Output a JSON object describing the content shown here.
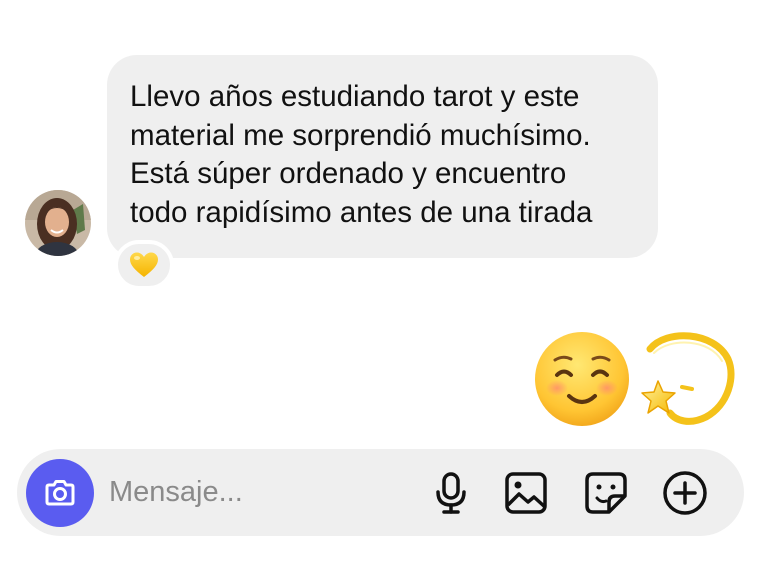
{
  "conversation": {
    "incoming": {
      "avatar_icon": "contact-avatar",
      "lines": [
        "Llevo años estudiando tarot y este",
        "material me sorprendió muchísimo.",
        "Está súper ordenado y encuentro",
        "todo rapidísimo antes de una tirada"
      ],
      "reaction_icon": "yellow-heart-icon"
    },
    "outgoing": {
      "emojis": [
        "smiling-face-icon",
        "dizzy-star-icon"
      ]
    }
  },
  "composer": {
    "placeholder": "Mensaje...",
    "value": "",
    "camera_icon": "camera-icon",
    "tools": [
      "microphone-icon",
      "gallery-icon",
      "sticker-icon",
      "plus-circle-icon"
    ],
    "accent_color": "#5a5cf0"
  }
}
